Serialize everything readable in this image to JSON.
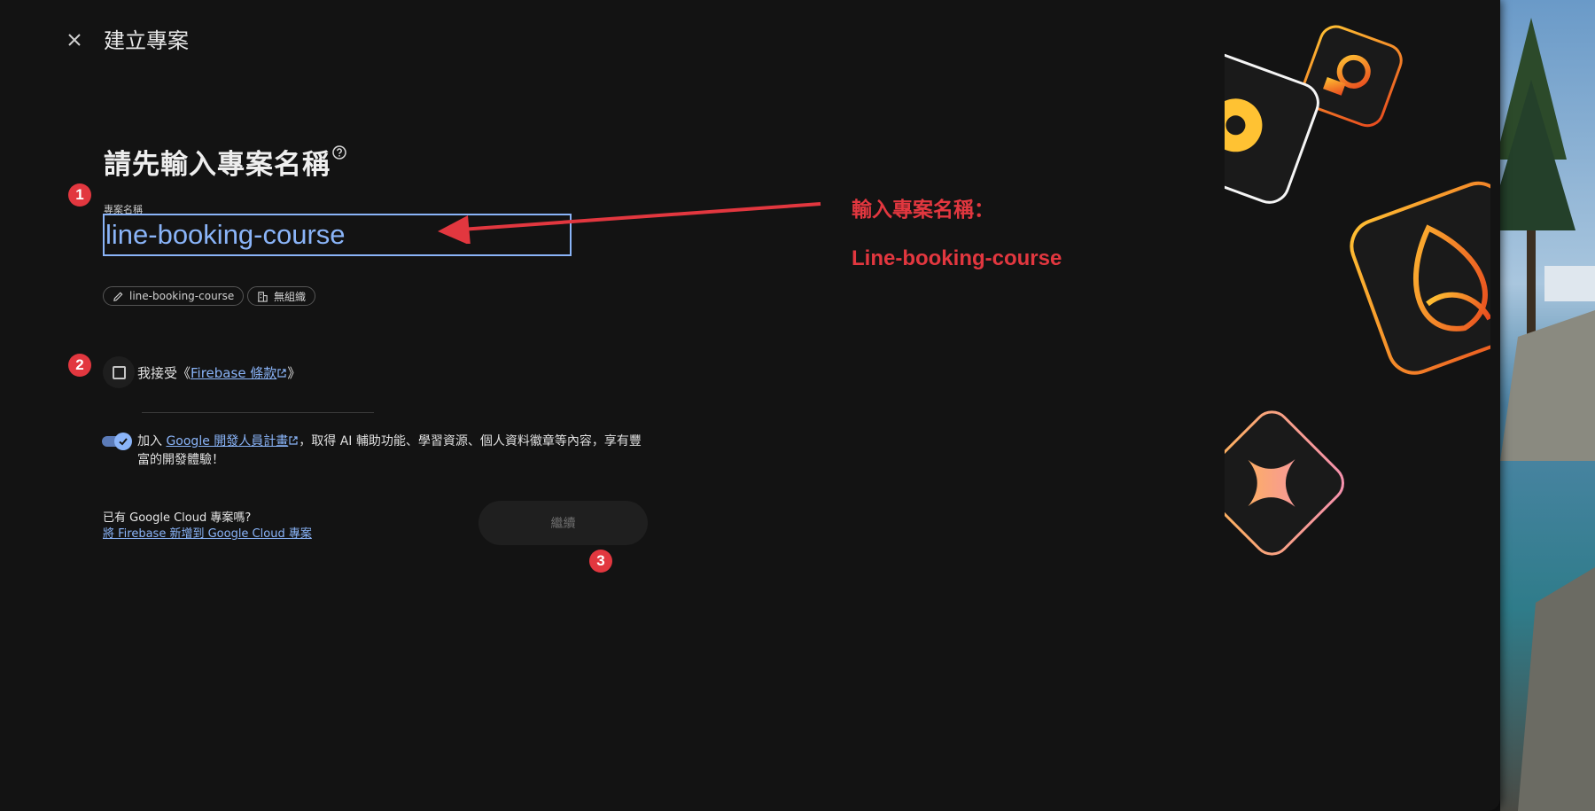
{
  "header": {
    "title": "建立專案"
  },
  "main": {
    "heading": "請先輸入專案名稱",
    "field_label": "專案名稱",
    "project_name_value": "line-booking-course",
    "chips": {
      "project_id": "line-booking-course",
      "organization": "無組織"
    },
    "terms": {
      "prefix": "我接受《",
      "link": "Firebase 條款",
      "suffix": "》"
    },
    "program": {
      "prefix": "加入 ",
      "link": "Google 開發人員計畫",
      "suffix": "，取得 AI 輔助功能、學習資源、個人資料徽章等內容，享有豐富的開發體驗！",
      "enabled": true
    },
    "existing_project_question": "已有 Google Cloud 專案嗎?",
    "existing_project_link": "將 Firebase 新增到 Google Cloud 專案",
    "continue_label": "繼續"
  },
  "annotations": {
    "badges": [
      "1",
      "2",
      "3"
    ],
    "title": "輸入專案名稱：",
    "value": "Line-booking-course",
    "color": "#e2373f"
  },
  "colors": {
    "accent": "#8ab4f8",
    "background": "#131313",
    "annotation": "#e2373f"
  },
  "icons": [
    "close-icon",
    "help-icon",
    "pencil-icon",
    "building-icon",
    "external-link-icon",
    "check-icon"
  ]
}
